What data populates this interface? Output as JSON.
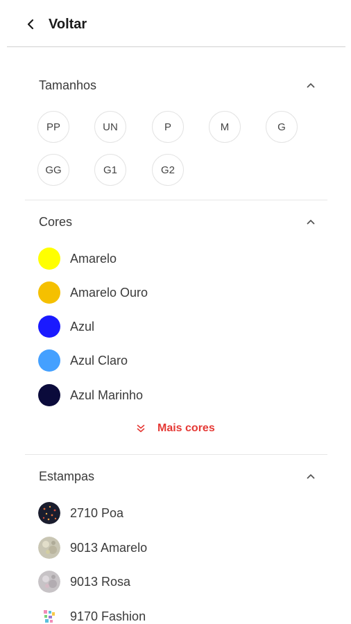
{
  "header": {
    "back_label": "Voltar"
  },
  "sizes": {
    "title": "Tamanhos",
    "options": [
      "PP",
      "UN",
      "P",
      "M",
      "G",
      "GG",
      "G1",
      "G2"
    ]
  },
  "colors": {
    "title": "Cores",
    "options": [
      {
        "label": "Amarelo",
        "hex": "#ffff00"
      },
      {
        "label": "Amarelo Ouro",
        "hex": "#f5c000"
      },
      {
        "label": "Azul",
        "hex": "#1a1aff"
      },
      {
        "label": "Azul Claro",
        "hex": "#44a0ff"
      },
      {
        "label": "Azul Marinho",
        "hex": "#0b0b3b"
      }
    ],
    "more_label": "Mais cores",
    "accent": "#e53935"
  },
  "prints": {
    "title": "Estampas",
    "options": [
      {
        "label": "2710 Poa"
      },
      {
        "label": "9013 Amarelo"
      },
      {
        "label": "9013 Rosa"
      },
      {
        "label": "9170 Fashion"
      }
    ]
  }
}
